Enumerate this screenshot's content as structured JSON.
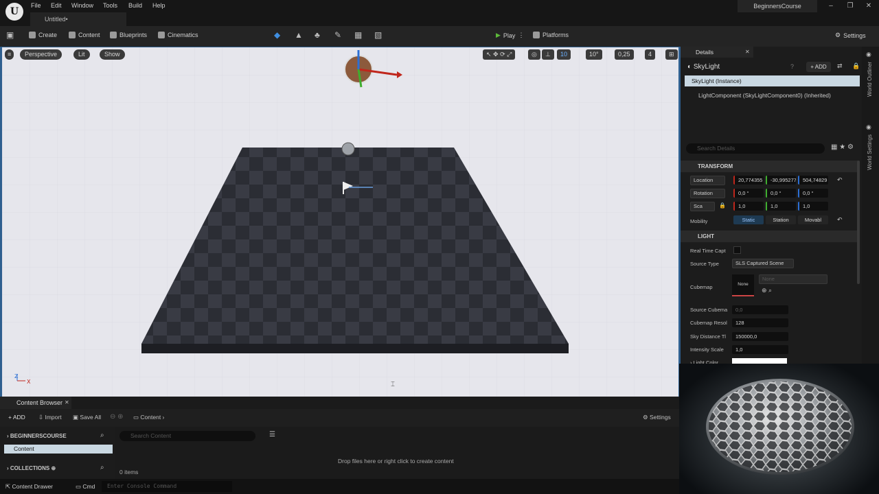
{
  "menubar": {
    "items": [
      "File",
      "Edit",
      "Window",
      "Tools",
      "Build",
      "Help"
    ],
    "doc_tab": "Untitled•",
    "project": "BeginnersCourse"
  },
  "toolbar": {
    "create": "Create",
    "content": "Content",
    "blueprints": "Blueprints",
    "cinematics": "Cinematics",
    "play": "Play",
    "platforms": "Platforms",
    "settings": "Settings"
  },
  "viewport": {
    "perspective": "Perspective",
    "lit": "Lit",
    "show": "Show",
    "grid": "10",
    "rot": "10°",
    "scale": "0,25",
    "cams": "4",
    "axis_z": "Z",
    "axis_x": "X"
  },
  "content_browser": {
    "tab": "Content Browser",
    "add": "ADD",
    "import": "Import",
    "save_all": "Save All",
    "path": "Content",
    "settings": "Settings",
    "project": "BEGINNERSCOURSE",
    "folder": "Content",
    "collections": "COLLECTIONS",
    "search": "Search Content",
    "empty": "Drop files here or right click to create content",
    "count": "0 items"
  },
  "statusbar": {
    "drawer": "Content Drawer",
    "cmd": "Cmd",
    "console": "Enter Console Command"
  },
  "details": {
    "tab": "Details",
    "actor": "SkyLight",
    "add": "ADD",
    "instance": "SkyLight (Instance)",
    "component": "LightComponent (SkyLightComponent0) (Inherited)",
    "search": "Search Details",
    "transform": "TRANSFORM",
    "location": "Location",
    "loc": [
      "20,774355",
      "-30,995277",
      "504,74829"
    ],
    "rotation": "Rotation",
    "rot": [
      "0,0 °",
      "0,0 °",
      "0,0 °"
    ],
    "scale": "Sca",
    "scl": [
      "1,0",
      "1,0",
      "1,0"
    ],
    "mobility": "Mobility",
    "mob": [
      "Static",
      "Station",
      "Movabl"
    ],
    "light": "LIGHT",
    "realtime": "Real Time Capt",
    "source_type": "Source Type",
    "source_val": "SLS Captured Scene",
    "cubemap": "Cubemap",
    "cube_none": "None",
    "cube_dd": "None",
    "source_cube": "Source Cubema",
    "source_cube_val": "0,0",
    "cube_res": "Cubemap Resol",
    "cube_res_val": "128",
    "sky_dist": "Sky Distance Tl",
    "sky_dist_val": "150000,0",
    "intensity": "Intensity Scale",
    "intensity_val": "1,0",
    "light_color": "Light Color"
  },
  "rightbar": {
    "outliner": "World Outliner",
    "world_settings": "World Settings"
  }
}
